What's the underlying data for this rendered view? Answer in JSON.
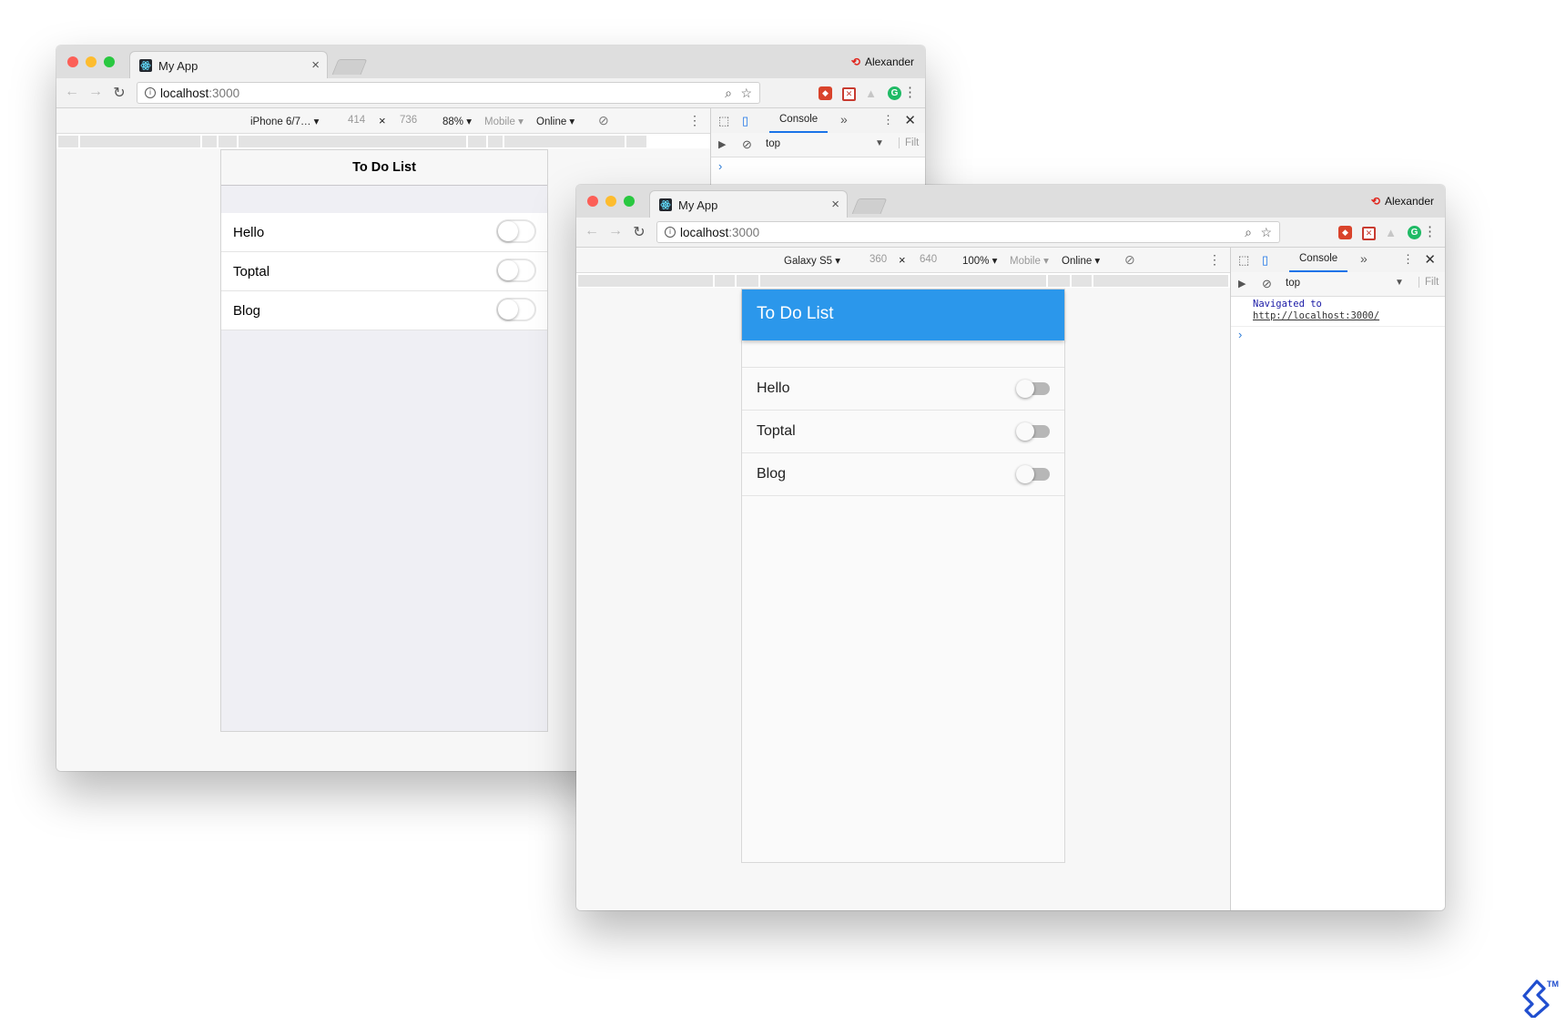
{
  "colors": {
    "md_primary": "#2b97eb",
    "toptal_blue": "#204ecf",
    "devtools_accent": "#1a73e8"
  },
  "icons": [
    "react-favicon-icon",
    "info-icon",
    "zoom-icon",
    "star-icon",
    "grammarly-icon",
    "close-icon",
    "rotate-icon",
    "inspect-icon",
    "device-toolbar-icon",
    "toptal-logo-icon"
  ],
  "window1": {
    "tab_title": "My App",
    "tab_close": "×",
    "profile_name": "Alexander",
    "url_host": "localhost",
    "url_port": ":3000",
    "devbar": {
      "device": "iPhone 6/7… ▾",
      "width": "414",
      "x": "×",
      "height": "736",
      "zoom": "88% ▾",
      "mode": "Mobile ▾",
      "network": "Online ▾"
    },
    "devtools": {
      "console_tab": "Console",
      "context": "top",
      "filter": "Filt",
      "prompt": "›"
    },
    "app": {
      "title": "To Do List",
      "items": [
        {
          "label": "Hello",
          "on": false
        },
        {
          "label": "Toptal",
          "on": false
        },
        {
          "label": "Blog",
          "on": false
        }
      ]
    }
  },
  "window2": {
    "tab_title": "My App",
    "tab_close": "×",
    "profile_name": "Alexander",
    "url_host": "localhost",
    "url_port": ":3000",
    "devbar": {
      "device": "Galaxy S5 ▾",
      "width": "360",
      "x": "×",
      "height": "640",
      "zoom": "100% ▾",
      "mode": "Mobile ▾",
      "network": "Online ▾"
    },
    "devtools": {
      "console_tab": "Console",
      "context": "top",
      "filter": "Filt",
      "log_prefix": "Navigated to ",
      "log_link": "http://localhost:3000/",
      "prompt": "›"
    },
    "app": {
      "title": "To Do List",
      "items": [
        {
          "label": "Hello",
          "on": false
        },
        {
          "label": "Toptal",
          "on": false
        },
        {
          "label": "Blog",
          "on": false
        }
      ]
    }
  },
  "watermark": {
    "tm": "TM"
  }
}
